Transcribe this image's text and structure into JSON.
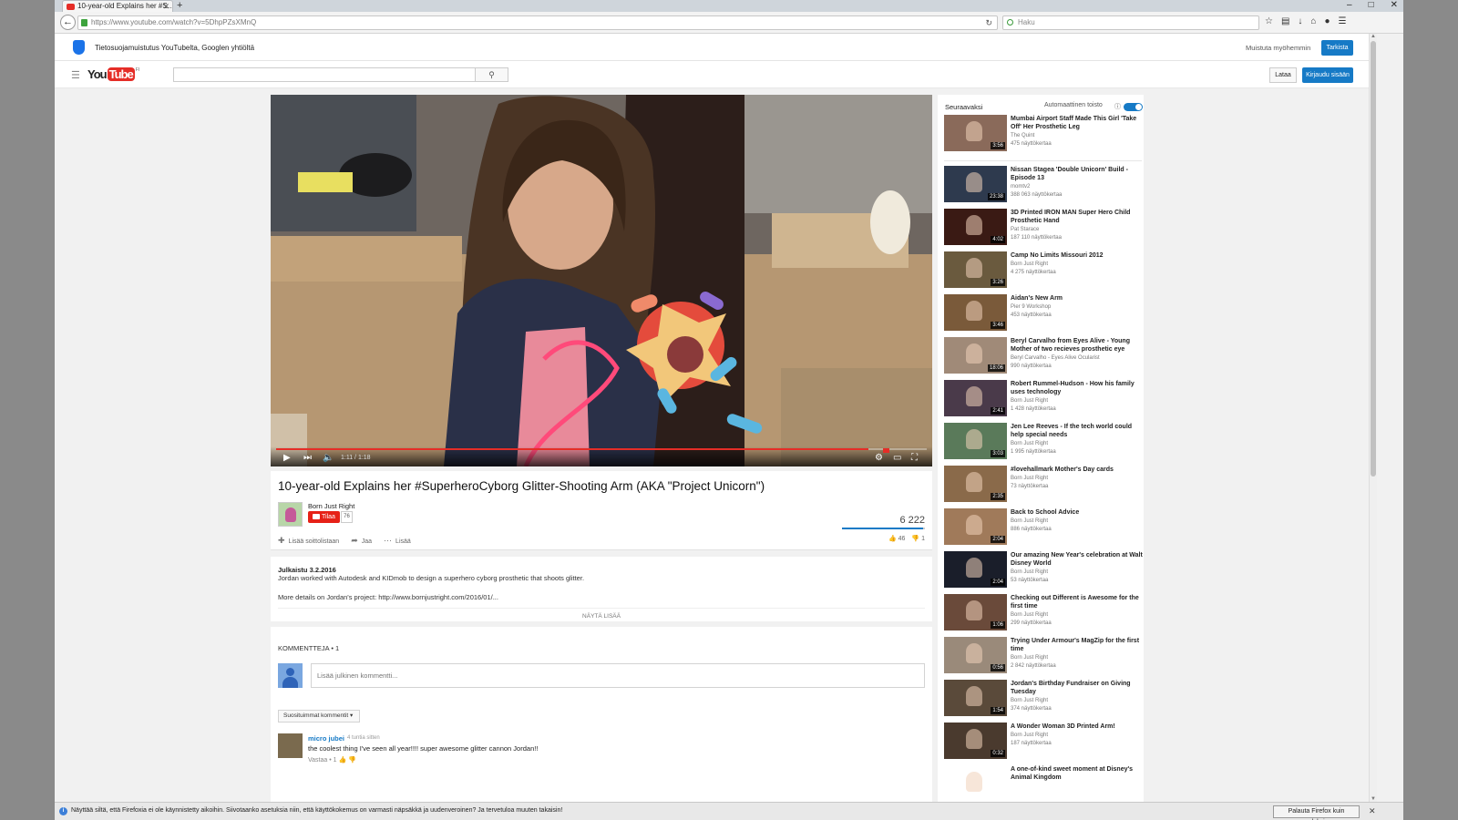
{
  "browser": {
    "tab_title": "10-year-old Explains her #S...",
    "tab_close": "✕",
    "new_tab": "+",
    "url": "https://www.youtube.com/watch?v=5DhpPZsXMnQ",
    "search_placeholder": "Haku",
    "window_buttons": [
      "–",
      "□",
      "✕"
    ]
  },
  "privacy_banner": {
    "text": "Tietosuojamuistutus YouTubelta, Googlen yhtiöltä",
    "remind_later": "Muistuta myöhemmin",
    "check_button": "Tarkista"
  },
  "masthead": {
    "logo_you": "You",
    "logo_tube": "Tube",
    "logo_region": "FI",
    "search_placeholder": "",
    "upload_button": "Lataa",
    "signin_button": "Kirjaudu sisään"
  },
  "player": {
    "time": "1:11 / 1:18",
    "progress_fraction": 0.91
  },
  "video": {
    "title": "10-year-old Explains her #SuperheroCyborg Glitter-Shooting Arm (AKA \"Project Unicorn\")",
    "channel": "Born Just Right",
    "subscribe_label": "Tilaa",
    "subscriber_count": "76",
    "views": "6 222",
    "add_to_playlist": "Lisää soittolistaan",
    "share": "Jaa",
    "more": "Lisää",
    "likes": "46",
    "dislikes": "1",
    "like_ratio": 0.98
  },
  "description": {
    "published": "Julkaistu 3.2.2016",
    "line1": "Jordan worked with Autodesk and KIDmob to design a superhero cyborg prosthetic that shoots glitter.",
    "line2": "More details on Jordan's project: http://www.bornjustright.com/2016/01/...",
    "show_more": "NÄYTÄ LISÄÄ"
  },
  "comments": {
    "header": "KOMMENTTEJA • 1",
    "input_placeholder": "Lisää julkinen kommentti...",
    "sort_label": "Suosituimmat kommentit ▾",
    "items": [
      {
        "author": "micro jubei",
        "time": "4 tuntia sitten",
        "text": "the coolest thing I've seen all year!!!!  super awesome glitter cannon Jordan!!",
        "reply": "Vastaa • 1"
      }
    ]
  },
  "sidebar": {
    "up_next_label": "Seuraavaksi",
    "autoplay_label": "Automaattinen toisto",
    "autoplay_on": true,
    "items": [
      {
        "title": "Mumbai Airport Staff Made This Girl 'Take Off' Her Prosthetic Leg",
        "channel": "The Quint",
        "views": "475 näyttökertaa",
        "duration": "3:56",
        "color": "#8a6a5a"
      },
      {
        "title": "Nissan Stagea 'Double Unicorn' Build - Episode 13",
        "channel": "momtv2",
        "views": "388 063 näyttökertaa",
        "duration": "23:38",
        "color": "#2e3a4e"
      },
      {
        "title": "3D Printed IRON MAN Super Hero Child Prosthetic Hand",
        "channel": "Pat Starace",
        "views": "187 110 näyttökertaa",
        "duration": "4:02",
        "color": "#3a1a14"
      },
      {
        "title": "Camp No Limits Missouri 2012",
        "channel": "Born Just Right",
        "views": "4 275 näyttökertaa",
        "duration": "3:26",
        "color": "#6a5a3e"
      },
      {
        "title": "Aidan's New Arm",
        "channel": "Pier 9 Workshop",
        "views": "453 näyttökertaa",
        "duration": "3:46",
        "color": "#7a5a3a"
      },
      {
        "title": "Beryl Carvalho from Eyes Alive - Young Mother of two recieves prosthetic eye",
        "channel": "Beryl Carvalho - Eyes Alive Ocularist",
        "views": "990 näyttökertaa",
        "duration": "18:06",
        "color": "#a08a78"
      },
      {
        "title": "Robert Rummel-Hudson - How his family uses technology",
        "channel": "Born Just Right",
        "views": "1 428 näyttökertaa",
        "duration": "2:41",
        "color": "#4a3a4a"
      },
      {
        "title": "Jen Lee Reeves - If the tech world could help special needs",
        "channel": "Born Just Right",
        "views": "1 995 näyttökertaa",
        "duration": "3:03",
        "color": "#5a7a5a"
      },
      {
        "title": "#lovehallmark Mother's Day cards",
        "channel": "Born Just Right",
        "views": "73 näyttökertaa",
        "duration": "2:35",
        "color": "#8a6a4a"
      },
      {
        "title": "Back to School Advice",
        "channel": "Born Just Right",
        "views": "886 näyttökertaa",
        "duration": "2:04",
        "color": "#a07a5a"
      },
      {
        "title": "Our amazing New Year's celebration at Walt Disney World",
        "channel": "Born Just Right",
        "views": "53 näyttökertaa",
        "duration": "2:04",
        "color": "#1a1e2a"
      },
      {
        "title": "Checking out Different is Awesome for the first time",
        "channel": "Born Just Right",
        "views": "299 näyttökertaa",
        "duration": "1:06",
        "color": "#6a4a3a"
      },
      {
        "title": "Trying Under Armour's MagZip for the first time",
        "channel": "Born Just Right",
        "views": "2 842 näyttökertaa",
        "duration": "0:56",
        "color": "#9a8a7a"
      },
      {
        "title": "Jordan's Birthday Fundraiser on Giving Tuesday",
        "channel": "Born Just Right",
        "views": "374 näyttökertaa",
        "duration": "1:54",
        "color": "#5a4a3a"
      },
      {
        "title": "A Wonder Woman 3D Printed Arm!",
        "channel": "Born Just Right",
        "views": "187 näyttökertaa",
        "duration": "0:32",
        "color": "#4a3a2e"
      },
      {
        "title": "A one-of-kind sweet moment at Disney's Animal Kingdom",
        "channel": "",
        "views": "",
        "duration": "",
        "color": "#ffffff"
      }
    ]
  },
  "notification": {
    "text": "Näyttää siltä, että Firefoxia ei ole käynnistetty aikoihin. Siivotaanko asetuksia niin, että käyttökokemus on varmasti näpsäkkä ja uudenveroinen? Ja tervetuloa muuten takaisin!",
    "button": "Palauta Firefox kuin uudeksi...",
    "close": "✕"
  }
}
